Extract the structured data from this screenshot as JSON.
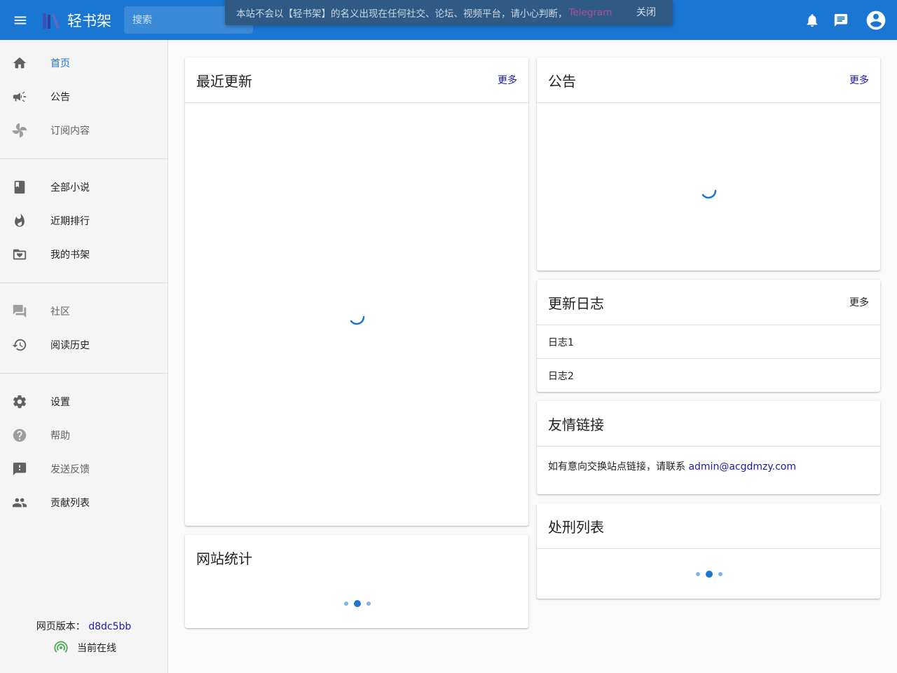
{
  "app": {
    "title": "轻书架"
  },
  "search": {
    "placeholder": "搜索"
  },
  "snackbar": {
    "message": "本站不会以【轻书架】的名义出现在任何社交、论坛、视频平台，请小心判断，",
    "link": "Telegram",
    "close": "关闭"
  },
  "sidebar": {
    "items": [
      {
        "label": "首页",
        "icon": "home-icon"
      },
      {
        "label": "公告",
        "icon": "megaphone-icon"
      },
      {
        "label": "订阅内容",
        "icon": "pinwheel-icon"
      },
      {
        "label": "全部小说",
        "icon": "book-icon"
      },
      {
        "label": "近期排行",
        "icon": "fire-icon"
      },
      {
        "label": "我的书架",
        "icon": "folder-heart-icon"
      },
      {
        "label": "社区",
        "icon": "forum-icon"
      },
      {
        "label": "阅读历史",
        "icon": "history-icon"
      },
      {
        "label": "设置",
        "icon": "gear-icon"
      },
      {
        "label": "帮助",
        "icon": "help-icon"
      },
      {
        "label": "发送反馈",
        "icon": "feedback-icon"
      },
      {
        "label": "贡献列表",
        "icon": "people-icon"
      }
    ],
    "version_label": "网页版本：",
    "version_value": "d8dc5bb",
    "online_status": "当前在线"
  },
  "cards": {
    "recent": {
      "title": "最近更新",
      "more": "更多"
    },
    "notice": {
      "title": "公告",
      "more": "更多"
    },
    "changelog": {
      "title": "更新日志",
      "more": "更多",
      "rows": [
        "日志1",
        "日志2"
      ]
    },
    "links": {
      "title": "友情链接",
      "text": "如有意向交换站点链接，请联系 ",
      "email": "admin@acgdmzy.com"
    },
    "stats": {
      "title": "网站统计"
    },
    "punish": {
      "title": "处刑列表"
    }
  },
  "colors": {
    "primary": "#1976d2",
    "link": "#1a1aa6",
    "online": "#4caf50"
  }
}
